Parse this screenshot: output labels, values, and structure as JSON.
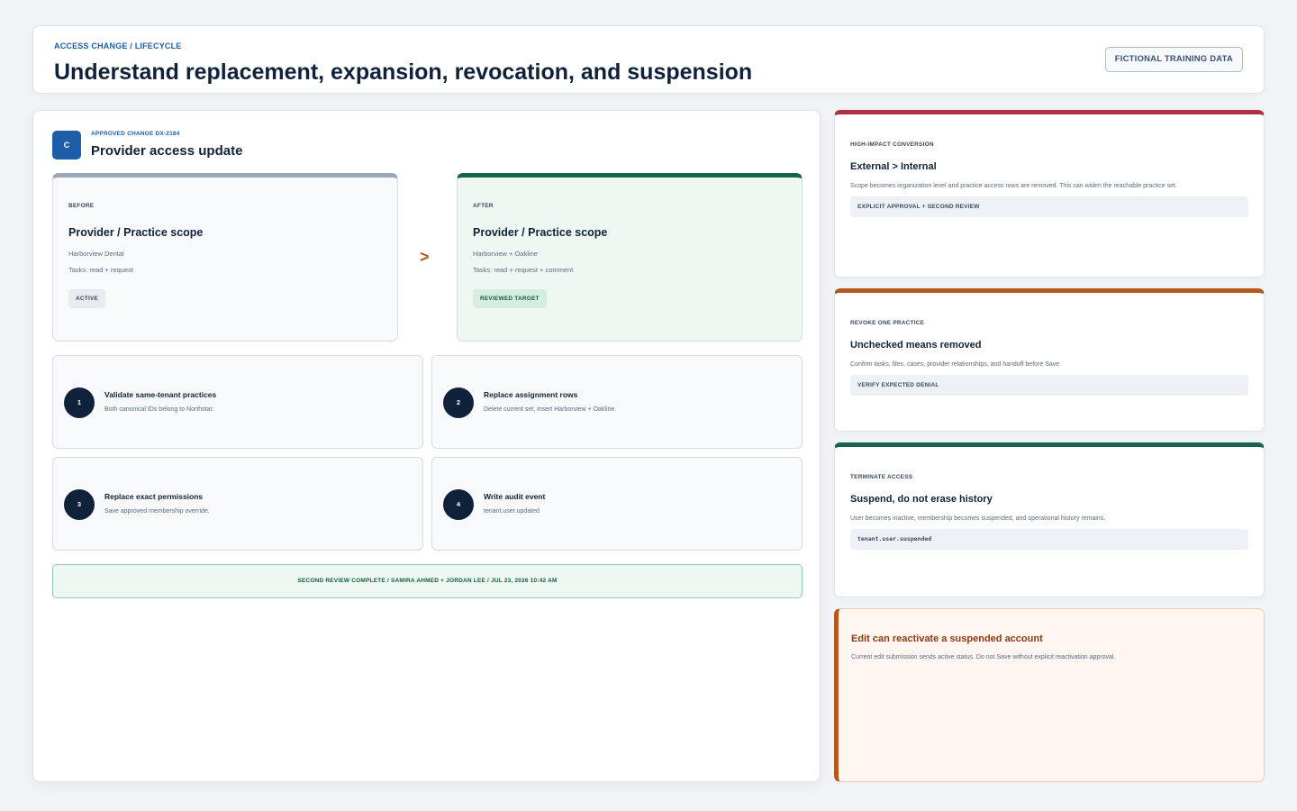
{
  "header": {
    "eyebrow": "ACCESS CHANGE / LIFECYCLE",
    "title": "Understand replacement, expansion, revocation, and suspension",
    "badge": "FICTIONAL TRAINING DATA"
  },
  "change": {
    "avatar": "C",
    "id": "APPROVED CHANGE DX-2184",
    "title": "Provider access update"
  },
  "before": {
    "label": "BEFORE",
    "title": "Provider / Practice scope",
    "line1": "Harborview Dental",
    "line2": "Tasks: read + request",
    "pill": "ACTIVE"
  },
  "arrow": ">",
  "after": {
    "label": "AFTER",
    "title": "Provider / Practice scope",
    "line1": "Harborview + Oakline",
    "line2": "Tasks: read + request + comment",
    "pill": "REVIEWED TARGET"
  },
  "steps": [
    {
      "num": "1",
      "title": "Validate same-tenant practices",
      "desc": "Both canonical IDs belong to Northstar."
    },
    {
      "num": "2",
      "title": "Replace assignment rows",
      "desc": "Delete current set, insert Harborview + Oakline."
    },
    {
      "num": "3",
      "title": "Replace exact permissions",
      "desc": "Save approved membership override."
    },
    {
      "num": "4",
      "title": "Write audit event",
      "desc": "tenant.user.updated"
    }
  ],
  "review": "SECOND REVIEW COMPLETE / SAMIRA AHMED + JORDAN LEE / JUL 23, 2026 10:42 AM",
  "cards": [
    {
      "kicker": "HIGH-IMPACT CONVERSION",
      "title": "External > Internal",
      "desc": "Scope becomes organization level and practice access rows are removed. This can widen the reachable practice set.",
      "tag": "EXPLICIT APPROVAL + SECOND REVIEW"
    },
    {
      "kicker": "REVOKE ONE PRACTICE",
      "title": "Unchecked means removed",
      "desc": "Confirm tasks, files, cases, provider relationships, and handoff before Save.",
      "tag": "VERIFY EXPECTED DENIAL"
    },
    {
      "kicker": "TERMINATE ACCESS",
      "title": "Suspend, do not erase history",
      "desc": "User becomes inactive, membership becomes suspended, and operational history remains.",
      "tag": "tenant.user.suspended"
    }
  ],
  "warning": {
    "title": "Edit can reactivate a suspended account",
    "desc": "Current edit submission sends active status. Do not Save without explicit reactivation approval."
  },
  "colors": {
    "accent": "#1f5da8",
    "navy": "#10223a",
    "danger": "#b02f42",
    "warning": "#b4581f",
    "success": "#16654a"
  }
}
